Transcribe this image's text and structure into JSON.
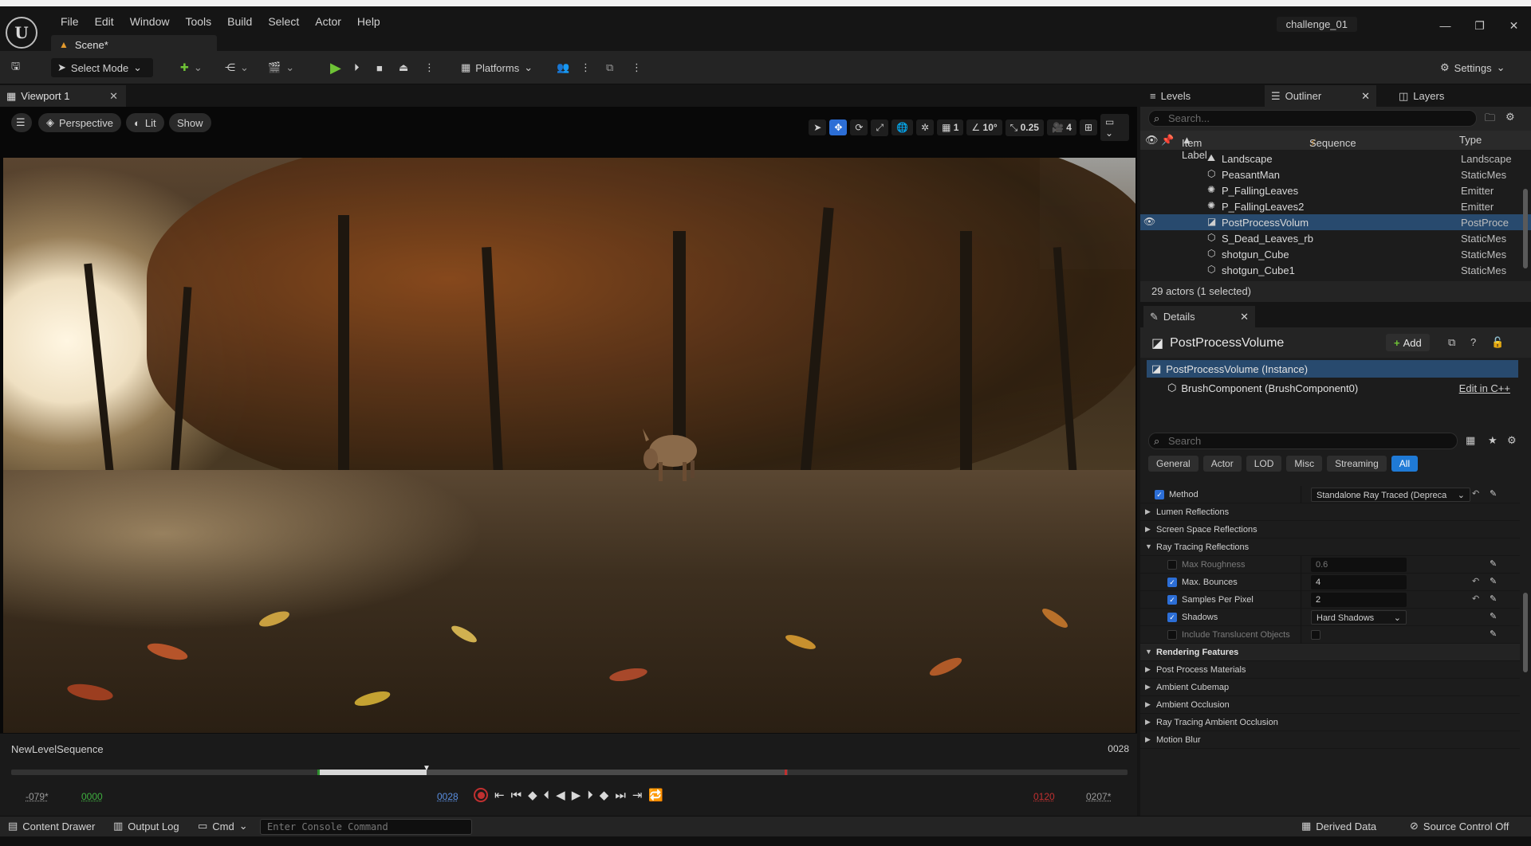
{
  "menu": [
    "File",
    "Edit",
    "Window",
    "Tools",
    "Build",
    "Select",
    "Actor",
    "Help"
  ],
  "window": {
    "scene_tab": "Scene*",
    "project": "challenge_01"
  },
  "toolbar": {
    "select_mode": "Select Mode",
    "platforms": "Platforms",
    "settings": "Settings"
  },
  "viewport": {
    "tab_label": "Viewport 1",
    "perspective": "Perspective",
    "lit": "Lit",
    "show": "Show",
    "grid_value": "1",
    "angle_value": "10°",
    "scale_value": "0.25",
    "camera_speed": "4"
  },
  "sequencer": {
    "name": "NewLevelSequence",
    "current_frame": "0028",
    "start_outer": "-079*",
    "start_green": "0000",
    "playhead": "0028",
    "end_red": "0120",
    "end_outer": "0207*",
    "playback_progress": 0.23
  },
  "statusbar": {
    "content_drawer": "Content Drawer",
    "output_log": "Output Log",
    "cmd": "Cmd",
    "console_placeholder": "Enter Console Command",
    "derived_data": "Derived Data",
    "source_control": "Source Control Off"
  },
  "outliner": {
    "tabs": [
      "Levels",
      "Outliner",
      "Layers"
    ],
    "search_placeholder": "Search...",
    "col_label": "Item Label",
    "col_sequence": "Sequence",
    "col_type": "Type",
    "rows": [
      {
        "label": "Landscape",
        "type": "Landscape",
        "icon": "landscape-icon"
      },
      {
        "label": "PeasantMan",
        "type": "StaticMes",
        "icon": "static-mesh-icon"
      },
      {
        "label": "P_FallingLeaves",
        "type": "Emitter",
        "icon": "emitter-icon"
      },
      {
        "label": "P_FallingLeaves2",
        "type": "Emitter",
        "icon": "emitter-icon"
      },
      {
        "label": "PostProcessVolum",
        "type": "PostProce",
        "icon": "post-process-icon",
        "selected": true
      },
      {
        "label": "S_Dead_Leaves_rb",
        "type": "StaticMes",
        "icon": "static-mesh-icon"
      },
      {
        "label": "shotgun_Cube",
        "type": "StaticMes",
        "icon": "static-mesh-icon"
      },
      {
        "label": "shotgun_Cube1",
        "type": "StaticMes",
        "icon": "static-mesh-icon"
      }
    ],
    "status": "29 actors (1 selected)"
  },
  "details": {
    "tab": "Details",
    "title": "PostProcessVolume",
    "add_label": "Add",
    "instance": "PostProcessVolume (Instance)",
    "component": "BrushComponent (BrushComponent0)",
    "edit_cpp": "Edit in C++",
    "search_placeholder": "Search",
    "filters": [
      "General",
      "Actor",
      "LOD",
      "Misc",
      "Streaming",
      "All"
    ],
    "properties": [
      {
        "name": "Method",
        "value": "Standalone Ray Traced (Depreca",
        "checkbox": "on",
        "kind": "combo",
        "indent": 1
      },
      {
        "name": "Lumen Reflections",
        "kind": "group",
        "indent": 0
      },
      {
        "name": "Screen Space Reflections",
        "kind": "group",
        "indent": 0
      },
      {
        "name": "Ray Tracing Reflections",
        "kind": "group-open",
        "indent": 0
      },
      {
        "name": "Max Roughness",
        "value": "0.6",
        "checkbox": "off",
        "kind": "disabled",
        "indent": 2
      },
      {
        "name": "Max. Bounces",
        "value": "4",
        "checkbox": "on",
        "kind": "number",
        "indent": 2
      },
      {
        "name": "Samples Per Pixel",
        "value": "2",
        "checkbox": "on",
        "kind": "number",
        "indent": 2
      },
      {
        "name": "Shadows",
        "value": "Hard Shadows",
        "checkbox": "on",
        "kind": "combo",
        "indent": 2
      },
      {
        "name": "Include Translucent Objects",
        "value": "",
        "checkbox": "off",
        "kind": "toggle-disabled",
        "indent": 2
      },
      {
        "name": "Rendering Features",
        "kind": "section",
        "indent": 0
      },
      {
        "name": "Post Process Materials",
        "kind": "group",
        "indent": 0
      },
      {
        "name": "Ambient Cubemap",
        "kind": "group",
        "indent": 0
      },
      {
        "name": "Ambient Occlusion",
        "kind": "group",
        "indent": 0
      },
      {
        "name": "Ray Tracing Ambient Occlusion",
        "kind": "group",
        "indent": 0
      },
      {
        "name": "Motion Blur",
        "kind": "group",
        "indent": 0
      }
    ]
  },
  "colors": {
    "accent": "#2c6ed6",
    "selected_row": "#284a6e",
    "play_green": "#6fc336",
    "record_red": "#c03030"
  }
}
